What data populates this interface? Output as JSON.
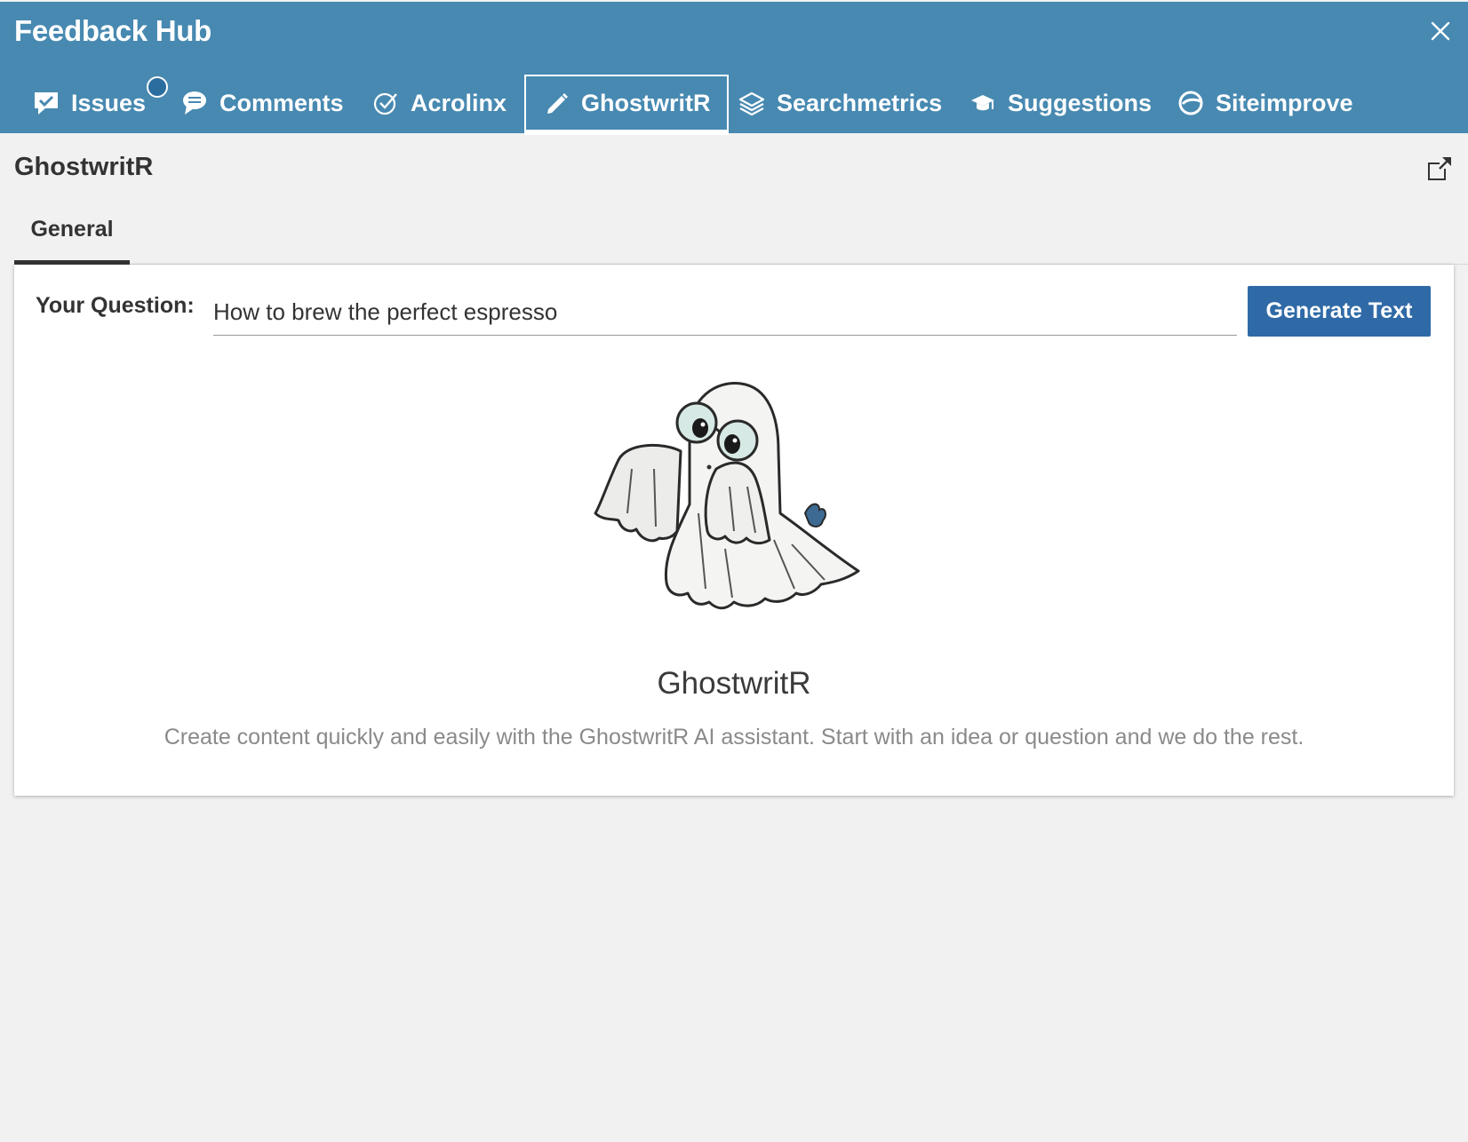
{
  "app": {
    "title": "Feedback Hub"
  },
  "tabs": [
    {
      "label": "Issues",
      "icon": "checked-comment-icon",
      "badge": "circle"
    },
    {
      "label": "Comments",
      "icon": "comment-icon"
    },
    {
      "label": "Acrolinx",
      "icon": "check-circle-icon"
    },
    {
      "label": "GhostwritR",
      "icon": "pencil-icon",
      "active": true
    },
    {
      "label": "Searchmetrics",
      "icon": "layers-icon"
    },
    {
      "label": "Suggestions",
      "icon": "graduation-cap-icon"
    },
    {
      "label": "Siteimprove",
      "icon": "siteimprove-icon"
    }
  ],
  "panel": {
    "title": "GhostwritR",
    "subtabs": [
      "General"
    ]
  },
  "form": {
    "question_label": "Your Question:",
    "question_value": "How to brew the perfect espresso",
    "generate_label": "Generate Text"
  },
  "intro": {
    "name": "GhostwritR",
    "description": "Create content quickly and easily with the GhostwritR AI assistant. Start with an idea or question and we do the rest."
  },
  "colors": {
    "header": "#4789b1",
    "button": "#2f6aa7",
    "background": "#f1f1f1"
  }
}
